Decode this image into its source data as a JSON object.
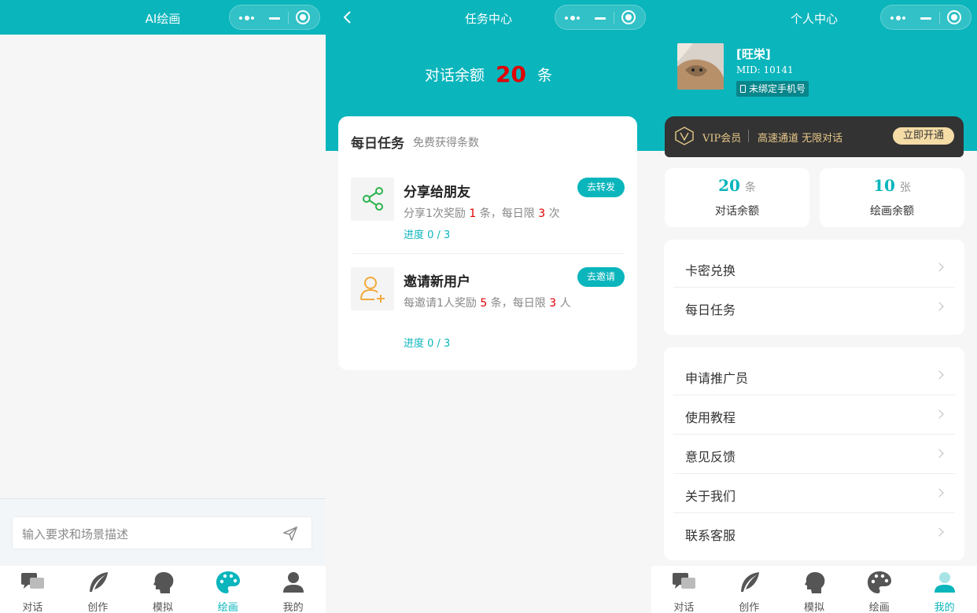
{
  "screen1": {
    "title": "AI绘画",
    "input_placeholder": "输入要求和场景描述",
    "tabs": [
      {
        "label": "对话",
        "icon": "chat-icon"
      },
      {
        "label": "创作",
        "icon": "feather-icon"
      },
      {
        "label": "模拟",
        "icon": "head-icon"
      },
      {
        "label": "绘画",
        "icon": "palette-icon",
        "active": true
      },
      {
        "label": "我的",
        "icon": "user-icon"
      }
    ]
  },
  "screen2": {
    "title": "任务中心",
    "balance_prefix": "对话余额",
    "balance_value": "20",
    "balance_unit": "条",
    "card_title": "每日任务",
    "card_subtitle": "免费获得条数",
    "tasks": [
      {
        "name": "分享给朋友",
        "desc_a": "分享1次奖励",
        "desc_n1": "1",
        "desc_b": "条，每日限",
        "desc_n2": "3",
        "desc_c": "次",
        "progress": "进度 0 / 3",
        "button": "去转发",
        "icon": "share-icon"
      },
      {
        "name": "邀请新用户",
        "desc_a": "每邀请1人奖励",
        "desc_n1": "5",
        "desc_b": "条，每日限",
        "desc_n2": "3",
        "desc_c": "人",
        "progress": "进度 0 / 3",
        "button": "去邀请",
        "icon": "add-user-icon"
      }
    ]
  },
  "screen3": {
    "title": "个人中心",
    "user_name": "[旺栄]",
    "user_mid": "MID: 10141",
    "phone_status": "未绑定手机号",
    "vip_label": "VIP会员",
    "vip_desc": "高速通道 无限对话",
    "vip_button": "立即开通",
    "stats": [
      {
        "value": "20",
        "unit": "条",
        "label": "对话余额"
      },
      {
        "value": "10",
        "unit": "张",
        "label": "绘画余额"
      }
    ],
    "menu_group1": [
      "卡密兑换",
      "每日任务"
    ],
    "menu_group2": [
      "申请推广员",
      "使用教程",
      "意见反馈",
      "关于我们",
      "联系客服"
    ],
    "tabs": [
      {
        "label": "对话",
        "icon": "chat-icon"
      },
      {
        "label": "创作",
        "icon": "feather-icon"
      },
      {
        "label": "模拟",
        "icon": "head-icon"
      },
      {
        "label": "绘画",
        "icon": "palette-icon"
      },
      {
        "label": "我的",
        "icon": "user-icon",
        "active": true
      }
    ]
  },
  "colors": {
    "primary": "#0ab5bc",
    "red": "#e10000",
    "vip_gold": "#e8c98a",
    "vip_bg": "#333333"
  }
}
